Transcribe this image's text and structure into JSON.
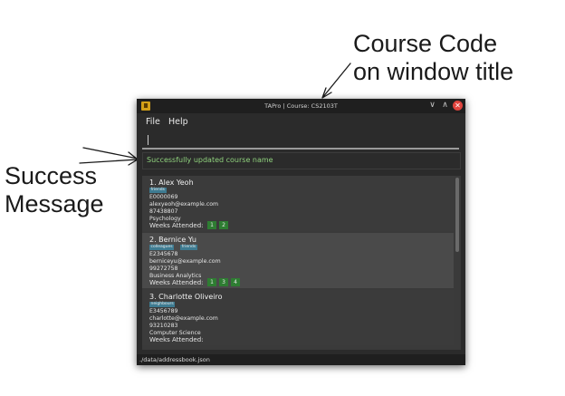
{
  "annotations": {
    "title_note": [
      "Course Code",
      "on window title"
    ],
    "success_note": [
      "Success",
      "Message"
    ]
  },
  "window": {
    "title": "TAPro | Course: CS2103T",
    "controls": {
      "minimize": "∨",
      "maximize": "∧",
      "close": "✕"
    }
  },
  "menu": {
    "file": "File",
    "help": "Help"
  },
  "command": {
    "value": ""
  },
  "result": {
    "message": "Successfully updated course name"
  },
  "students": [
    {
      "name": "1.  Alex Yeoh",
      "tags": [
        "friends"
      ],
      "id": "E0000069",
      "email": "alexyeoh@example.com",
      "phone": "87438807",
      "major": "Psychology",
      "weeks_label": "Weeks Attended:",
      "weeks": [
        "1",
        "2"
      ]
    },
    {
      "name": "2.  Bernice Yu",
      "tags": [
        "colleagues",
        "friends"
      ],
      "id": "E2345678",
      "email": "berniceyu@example.com",
      "phone": "99272758",
      "major": "Business Analytics",
      "weeks_label": "Weeks Attended:",
      "weeks": [
        "1",
        "3",
        "4"
      ]
    },
    {
      "name": "3.  Charlotte Oliveiro",
      "tags": [
        "neighbours"
      ],
      "id": "E3456789",
      "email": "charlotte@example.com",
      "phone": "93210283",
      "major": "Computer Science",
      "weeks_label": "Weeks Attended:",
      "weeks": []
    }
  ],
  "status": {
    "path": "./data/addressbook.json"
  },
  "colors": {
    "window_bg": "#2b2b2b",
    "titlebar": "#1f1f1f",
    "success_text": "#8fd17d",
    "tag": "#3e7b91",
    "week_badge": "#2e7d32",
    "close_button": "#e0443e"
  },
  "icons": {
    "app": "app-icon",
    "close": "close-icon",
    "minimize": "chevron-down-icon",
    "maximize": "chevron-up-icon"
  }
}
